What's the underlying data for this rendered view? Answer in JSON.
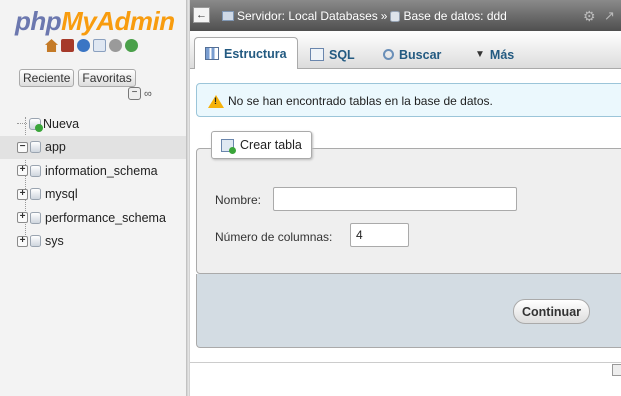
{
  "app": {
    "logo_part1": "php",
    "logo_part2": "MyAdmin"
  },
  "nav": {
    "icons": [
      "home-icon",
      "exit-icon",
      "help-icon",
      "docs-icon",
      "settings-icon",
      "reload-icon"
    ],
    "tabs": [
      "Reciente",
      "Favoritas"
    ],
    "tree": [
      {
        "label": "Nueva",
        "type": "new"
      },
      {
        "label": "app",
        "type": "db",
        "expanded": true,
        "selected": true
      },
      {
        "label": "information_schema",
        "type": "db"
      },
      {
        "label": "mysql",
        "type": "db"
      },
      {
        "label": "performance_schema",
        "type": "db"
      },
      {
        "label": "sys",
        "type": "db"
      }
    ]
  },
  "breadcrumb": {
    "server": "Servidor: Local Databases",
    "separator": "»",
    "database": "Base de datos: ddd"
  },
  "tabs": {
    "structure": "Estructura",
    "sql": "SQL",
    "search": "Buscar",
    "more": "Más"
  },
  "notice": {
    "text": "No se han encontrado tablas en la base de datos."
  },
  "create_table": {
    "legend": "Crear tabla",
    "name_label": "Nombre:",
    "name_value": "",
    "columns_label": "Número de columnas:",
    "columns_value": "4",
    "submit": "Continuar"
  },
  "colors": {
    "logo_primary": "#6c78af",
    "logo_accent": "#f89c0e",
    "tab_text": "#235a81",
    "notice_bg": "#ebf8fd",
    "warning": "#f6b20a"
  }
}
